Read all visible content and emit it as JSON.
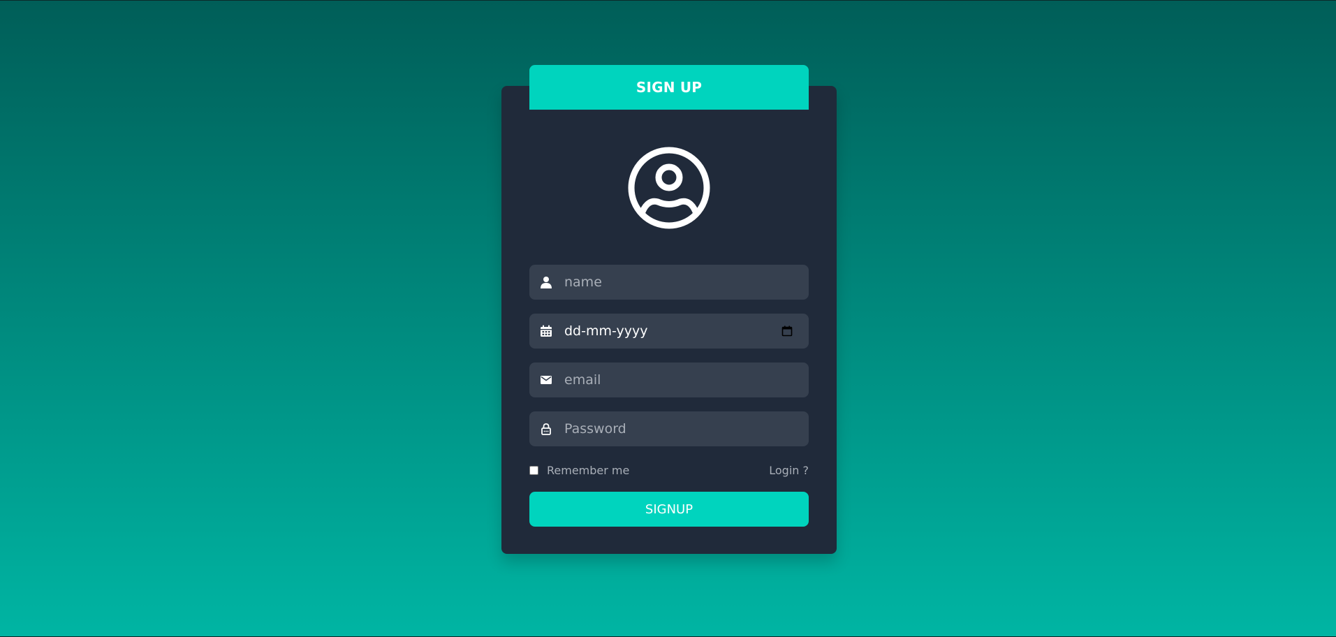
{
  "form": {
    "header_title": "SIGN UP",
    "avatar_icon": "user-circle-icon",
    "fields": {
      "name": {
        "placeholder": "name",
        "icon": "user-icon"
      },
      "birthdate": {
        "value": "dd-mm-yyyy",
        "icon": "calendar-icon",
        "picker_icon": "calendar-picker-icon"
      },
      "email": {
        "placeholder": "email",
        "icon": "envelope-icon"
      },
      "password": {
        "placeholder": "Password",
        "icon": "lock-icon"
      }
    },
    "remember_label": "Remember me",
    "remember_checked": false,
    "login_link": "Login ?",
    "submit_label": "SIGNUP"
  },
  "colors": {
    "accent": "#00d4be",
    "card_bg": "#202a3a",
    "field_bg": "#36404f",
    "bg_top": "#005e58",
    "bg_bottom": "#00b5a3",
    "muted_text": "#a9afb8"
  }
}
